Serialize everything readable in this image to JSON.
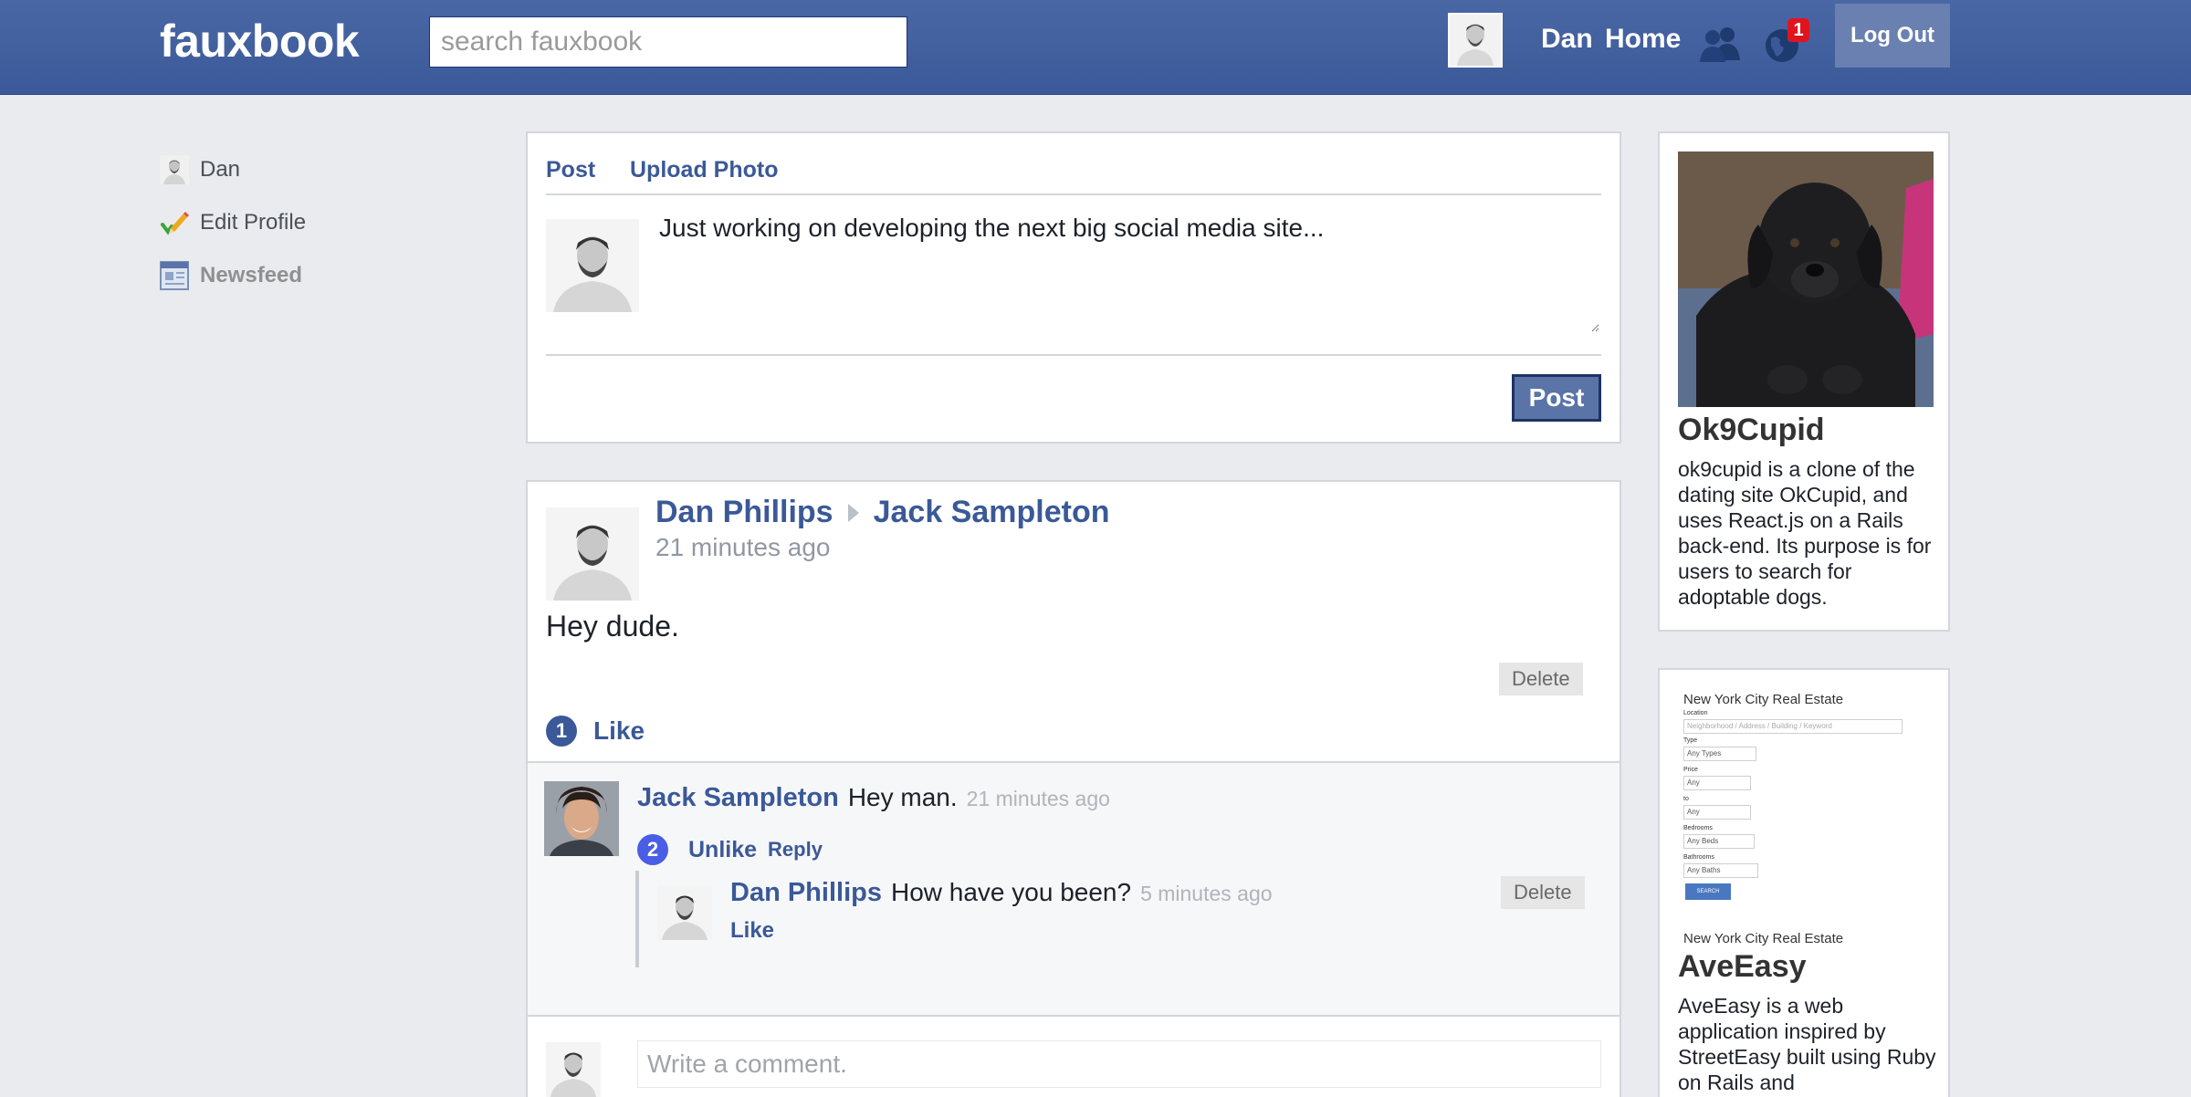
{
  "header": {
    "logo": "fauxbook",
    "search_placeholder": "search fauxbook",
    "user_name": "Dan",
    "home": "Home",
    "notification_count": "1",
    "logout": "Log Out"
  },
  "sidebar": {
    "items": [
      {
        "label": "Dan",
        "icon": "profile-avatar-icon"
      },
      {
        "label": "Edit Profile",
        "icon": "pencil-check-icon"
      },
      {
        "label": "Newsfeed",
        "icon": "newsfeed-icon"
      }
    ]
  },
  "composer": {
    "tab_post": "Post",
    "tab_upload": "Upload Photo",
    "text": "Just working on developing the next big social media site...",
    "post_button": "Post"
  },
  "post": {
    "author": "Dan Phillips",
    "recipient": "Jack Sampleton",
    "time": "21 minutes ago",
    "body": "Hey dude.",
    "delete": "Delete",
    "like_count": "1",
    "like_label": "Like",
    "comments": [
      {
        "author": "Jack Sampleton",
        "text": "Hey man.",
        "time": "21 minutes ago",
        "like_count": "2",
        "unlike": "Unlike",
        "reply": "Reply",
        "replies": [
          {
            "author": "Dan Phillips",
            "text": "How have you been?",
            "time": "5 minutes ago",
            "like": "Like",
            "delete": "Delete"
          }
        ]
      }
    ],
    "comment_placeholder": "Write a comment."
  },
  "ads": [
    {
      "title": "Ok9Cupid",
      "description": "ok9cupid is a clone of the dating site OkCupid, and uses React.js on a Rails back-end. Its purpose is for users to search for adoptable dogs."
    },
    {
      "title": "AveEasy",
      "description": "AveEasy is a web application inspired by StreetEasy built using Ruby on Rails and",
      "screenshot": {
        "heading": "New York City Real Estate",
        "location_label": "Location",
        "location_placeholder": "Neighborhood / Address / Building / Keyword",
        "type_label": "Type",
        "type_value": "Any Types",
        "price_label": "Price",
        "price_from": "Any",
        "to_label": "to",
        "price_to": "Any",
        "bedrooms_label": "Bedrooms",
        "bedrooms_value": "Any Beds",
        "bathrooms_label": "Bathrooms",
        "bathrooms_value": "Any Baths",
        "search_button": "SEARCH",
        "footer": "New York City Real Estate"
      }
    }
  ],
  "colors": {
    "brand": "#3b5998",
    "background": "#e9ebee",
    "badge": "#e0141e",
    "post_like_badge": "#3b5998",
    "comment_like_badge": "#4a5de6"
  }
}
